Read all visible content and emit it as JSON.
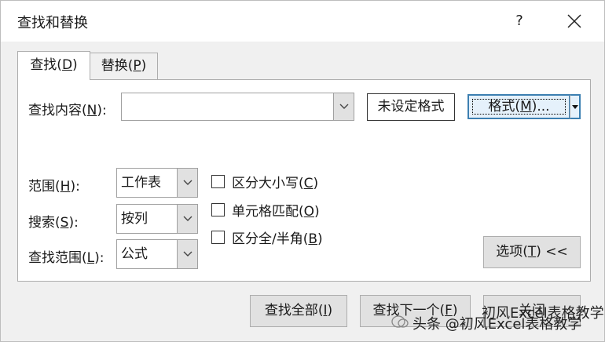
{
  "window": {
    "title": "查找和替换",
    "help": "?"
  },
  "tabs": [
    {
      "label_prefix": "查找(",
      "mnemonic": "D",
      "label_suffix": ")"
    },
    {
      "label_prefix": "替换(",
      "mnemonic": "P",
      "label_suffix": ")"
    }
  ],
  "find": {
    "label_prefix": "查找内容(",
    "mnemonic": "N",
    "label_suffix": "):",
    "value": "",
    "format_status": "未设定格式",
    "format_button": {
      "prefix": "格式(",
      "mnemonic": "M",
      "suffix": ")..."
    }
  },
  "options": {
    "scope": {
      "label_prefix": "范围(",
      "mnemonic": "H",
      "label_suffix": "):",
      "value": "工作表"
    },
    "search": {
      "label_prefix": "搜索(",
      "mnemonic": "S",
      "label_suffix": "):",
      "value": "按列"
    },
    "look_in": {
      "label_prefix": "查找范围(",
      "mnemonic": "L",
      "label_suffix": "):",
      "value": "公式"
    }
  },
  "checkboxes": [
    {
      "prefix": "区分大小写(",
      "mnemonic": "C",
      "suffix": ")",
      "checked": false
    },
    {
      "prefix": "单元格匹配(",
      "mnemonic": "O",
      "suffix": ")",
      "checked": false
    },
    {
      "prefix": "区分全/半角(",
      "mnemonic": "B",
      "suffix": ")",
      "checked": false
    }
  ],
  "options_button": {
    "prefix": "选项(",
    "mnemonic": "T",
    "suffix": ") <<"
  },
  "footer": {
    "find_all": {
      "prefix": "查找全部(",
      "mnemonic": "I",
      "suffix": ")"
    },
    "find_next": {
      "prefix": "查找下一个(",
      "mnemonic": "F",
      "suffix": ")"
    },
    "close": "关闭"
  },
  "watermark": {
    "text": "头条 @初风Excel表格教学",
    "faint": "初风Excel表格教学"
  }
}
